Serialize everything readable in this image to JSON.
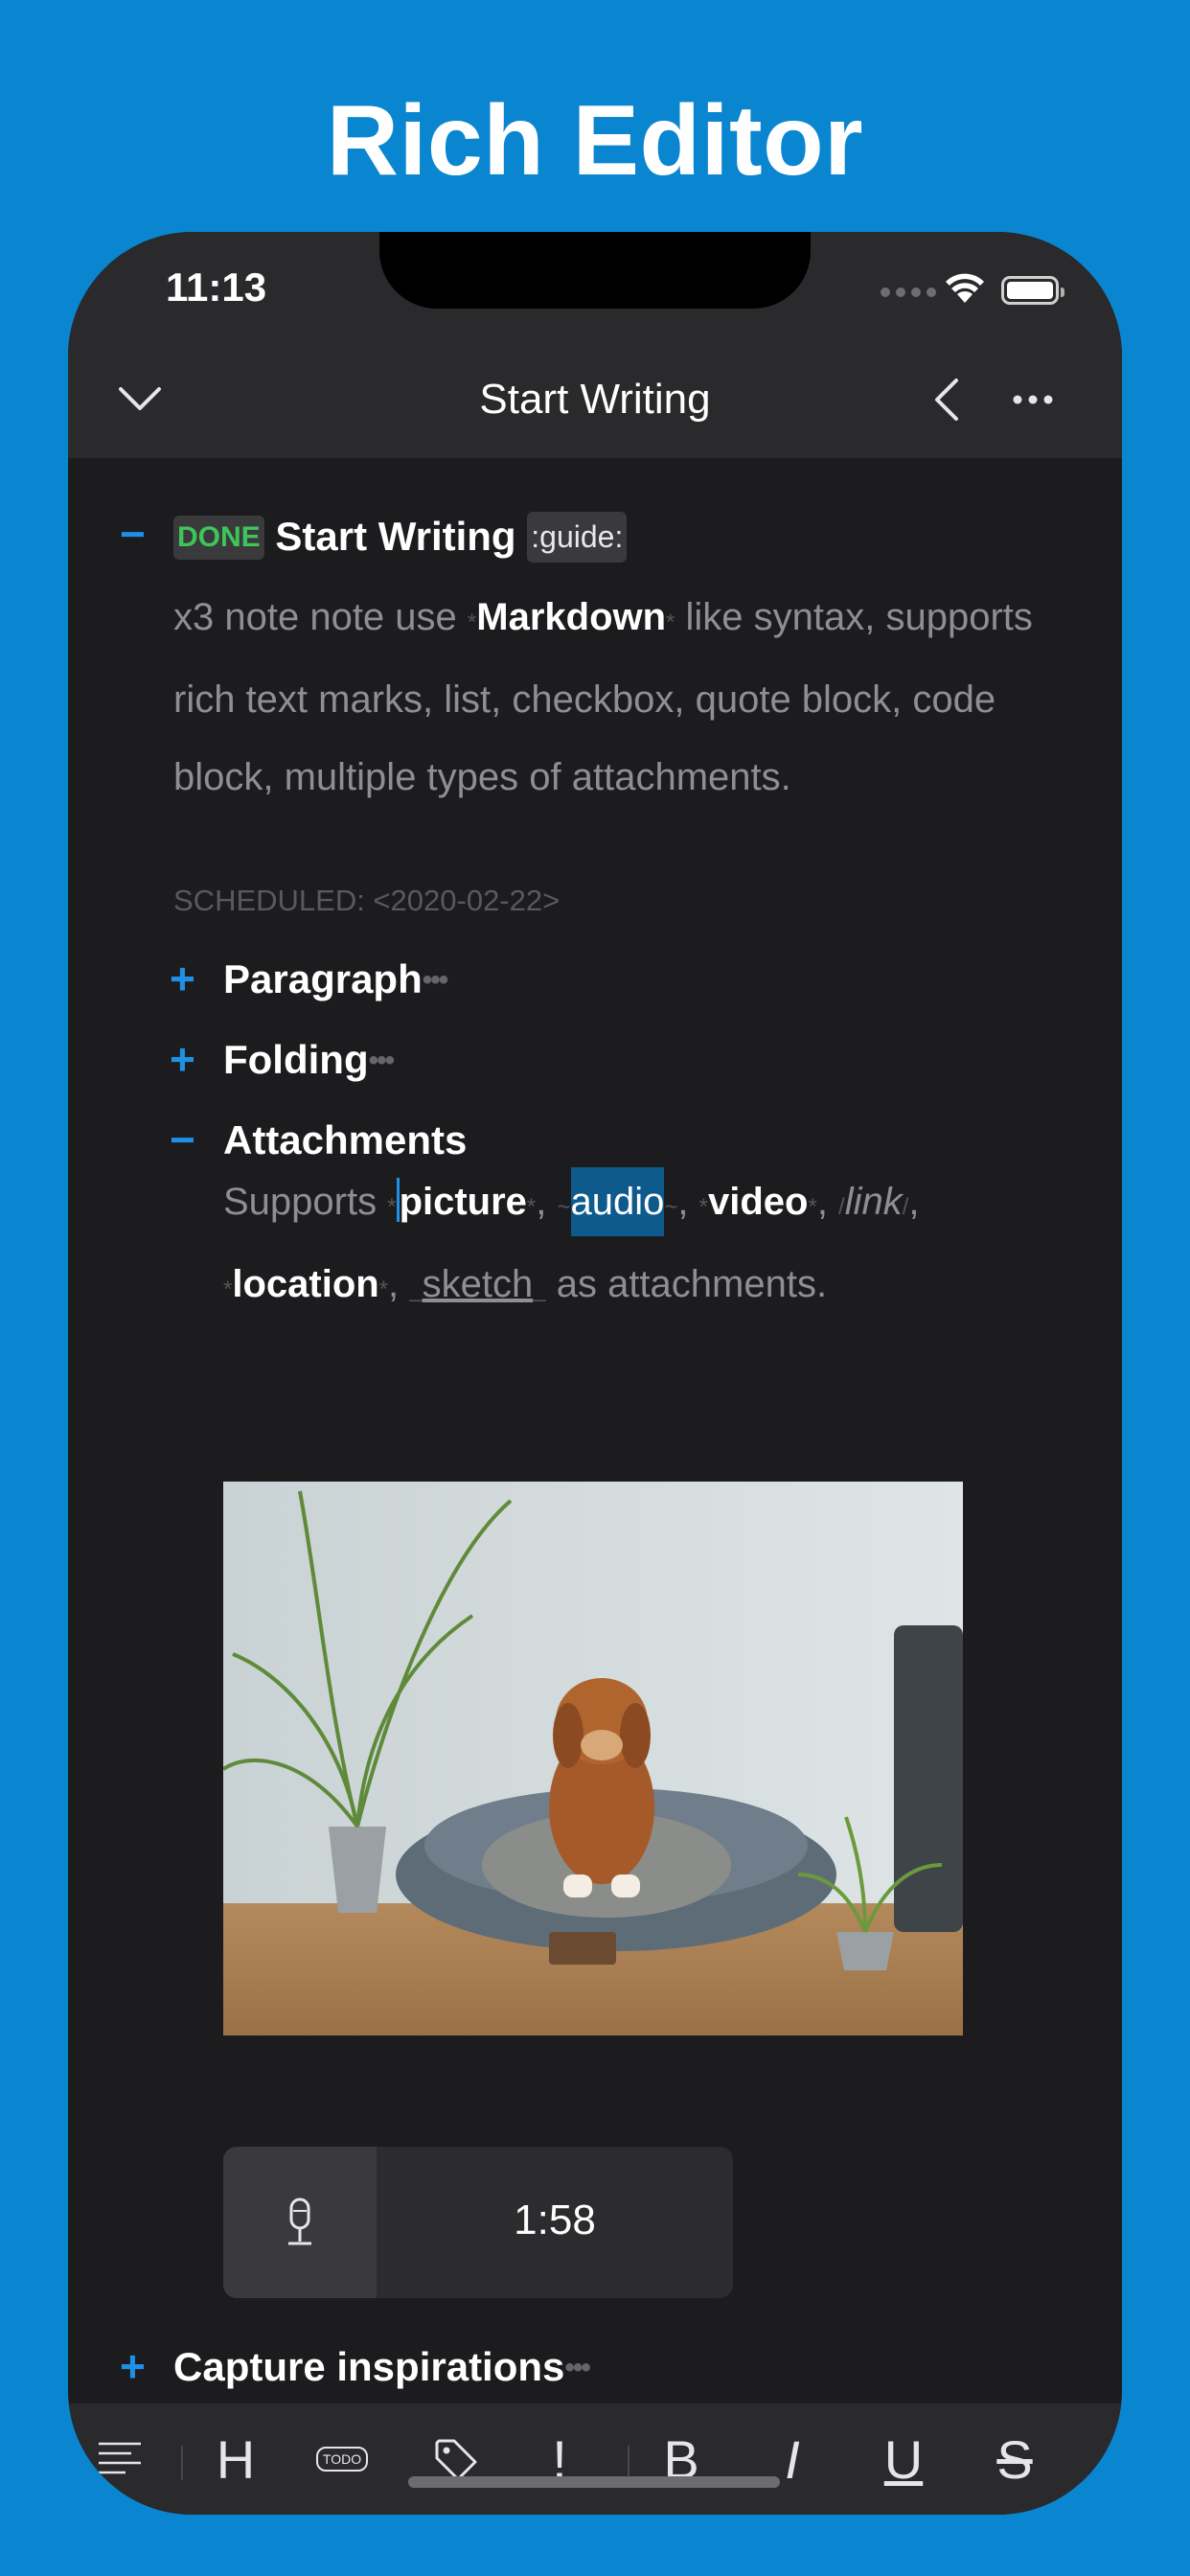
{
  "banner": {
    "title": "Rich Editor"
  },
  "status_bar": {
    "time": "11:13"
  },
  "nav": {
    "title": "Start Writing"
  },
  "doc": {
    "main": {
      "toggle": "−",
      "tag": "DONE",
      "title": "Start Writing",
      "label": ":guide:",
      "body_pre": "x3 note note use ",
      "mark_open": "*",
      "bold": "Markdown",
      "mark_close": "*",
      "body_post": " like syntax, supports rich text marks, list, checkbox, quote block, code block, multiple types of attachments.",
      "scheduled": "SCHEDULED: <2020-02-22>"
    },
    "sections": [
      {
        "toggle": "+",
        "title": "Paragraph",
        "more": "•••"
      },
      {
        "toggle": "+",
        "title": "Folding",
        "more": "•••"
      },
      {
        "toggle": "−",
        "title": "Attachments"
      }
    ],
    "attachments": {
      "supports": "Supports ",
      "star": "*",
      "tilde": "~",
      "slash": "/",
      "under": "_",
      "comma": ", ",
      "picture": "picture",
      "audio": "audio",
      "video": "video",
      "link": "link",
      "location": "location",
      "sketch": "sketch",
      "tail": " as attachments."
    },
    "audio_player": {
      "duration": "1:58"
    },
    "capture": {
      "toggle": "+",
      "title": "Capture inspirations",
      "more": "•••"
    }
  },
  "toolbar": {
    "heading": "H",
    "todo": "TODO",
    "priority": "!",
    "bold": "B",
    "italic": "I",
    "underline": "U",
    "strike": "S"
  },
  "colors": {
    "background": "#0a86d0",
    "editor": "#1c1c1e",
    "accent": "#1e90e6",
    "done": "#3ec55a"
  }
}
